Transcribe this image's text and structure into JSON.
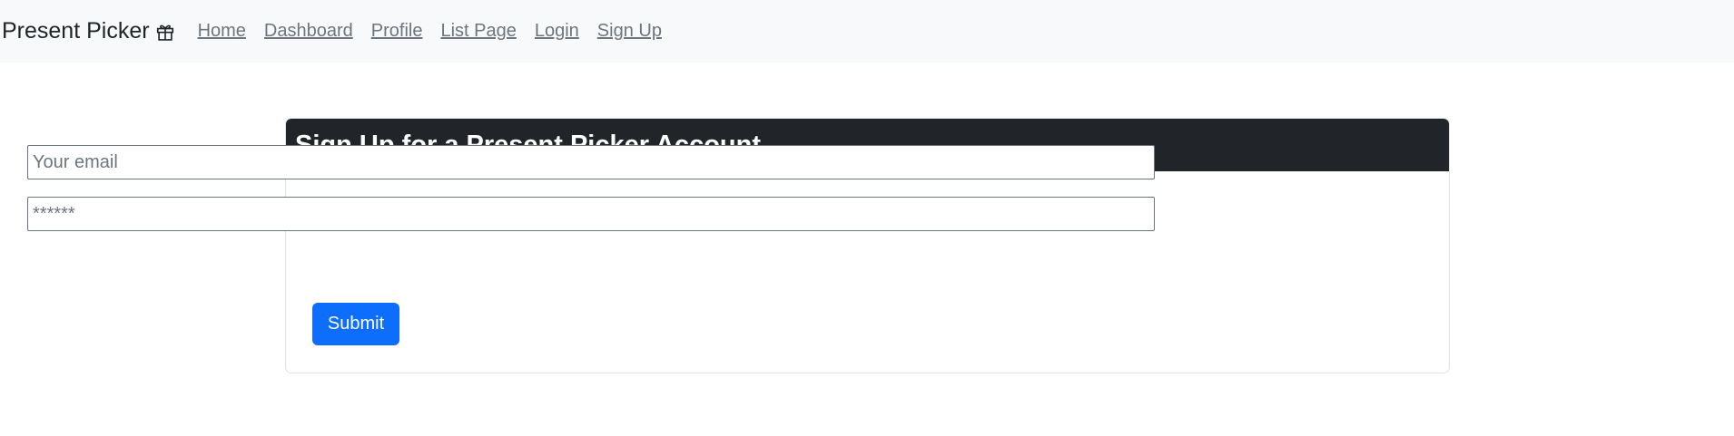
{
  "navbar": {
    "brand": "Present Picker",
    "brand_icon": "gift-icon",
    "links": [
      {
        "label": "Home"
      },
      {
        "label": "Dashboard"
      },
      {
        "label": "Profile"
      },
      {
        "label": "List Page"
      },
      {
        "label": "Login"
      },
      {
        "label": "Sign Up"
      }
    ]
  },
  "signup": {
    "title": "Sign Up for a Present Picker Account",
    "email_placeholder": "Your email",
    "email_value": "",
    "password_placeholder": "******",
    "password_value": "",
    "submit_label": "Submit"
  },
  "colors": {
    "navbar_bg": "#f8f9fa",
    "header_bg": "#212529",
    "primary": "#0d6efd",
    "link": "#6c757d"
  }
}
